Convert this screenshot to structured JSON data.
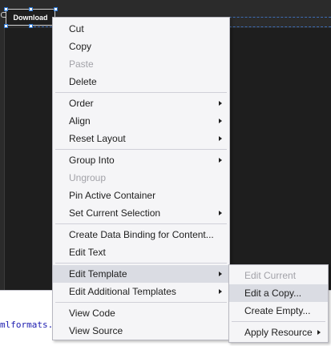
{
  "designer": {
    "button_label": "Download"
  },
  "code_panel": {
    "text": "mlformats."
  },
  "context_menu": {
    "groups": [
      [
        {
          "label": "Cut",
          "disabled": false,
          "submenu": false
        },
        {
          "label": "Copy",
          "disabled": false,
          "submenu": false
        },
        {
          "label": "Paste",
          "disabled": true,
          "submenu": false
        },
        {
          "label": "Delete",
          "disabled": false,
          "submenu": false
        }
      ],
      [
        {
          "label": "Order",
          "disabled": false,
          "submenu": true
        },
        {
          "label": "Align",
          "disabled": false,
          "submenu": true
        },
        {
          "label": "Reset Layout",
          "disabled": false,
          "submenu": true
        }
      ],
      [
        {
          "label": "Group Into",
          "disabled": false,
          "submenu": true
        },
        {
          "label": "Ungroup",
          "disabled": true,
          "submenu": false
        },
        {
          "label": "Pin Active Container",
          "disabled": false,
          "submenu": false
        },
        {
          "label": "Set Current Selection",
          "disabled": false,
          "submenu": true
        }
      ],
      [
        {
          "label": "Create Data Binding for Content...",
          "disabled": false,
          "submenu": false
        },
        {
          "label": "Edit Text",
          "disabled": false,
          "submenu": false
        }
      ],
      [
        {
          "label": "Edit Template",
          "disabled": false,
          "submenu": true,
          "highlighted": true
        },
        {
          "label": "Edit Additional Templates",
          "disabled": false,
          "submenu": true
        }
      ],
      [
        {
          "label": "View Code",
          "disabled": false,
          "submenu": false
        },
        {
          "label": "View Source",
          "disabled": false,
          "submenu": false
        }
      ]
    ]
  },
  "template_submenu": {
    "groups": [
      [
        {
          "label": "Edit Current",
          "disabled": true,
          "submenu": false
        },
        {
          "label": "Edit a Copy...",
          "disabled": false,
          "submenu": false,
          "highlighted": true
        },
        {
          "label": "Create Empty...",
          "disabled": false,
          "submenu": false
        }
      ],
      [
        {
          "label": "Apply Resource",
          "disabled": false,
          "submenu": true
        }
      ]
    ]
  }
}
